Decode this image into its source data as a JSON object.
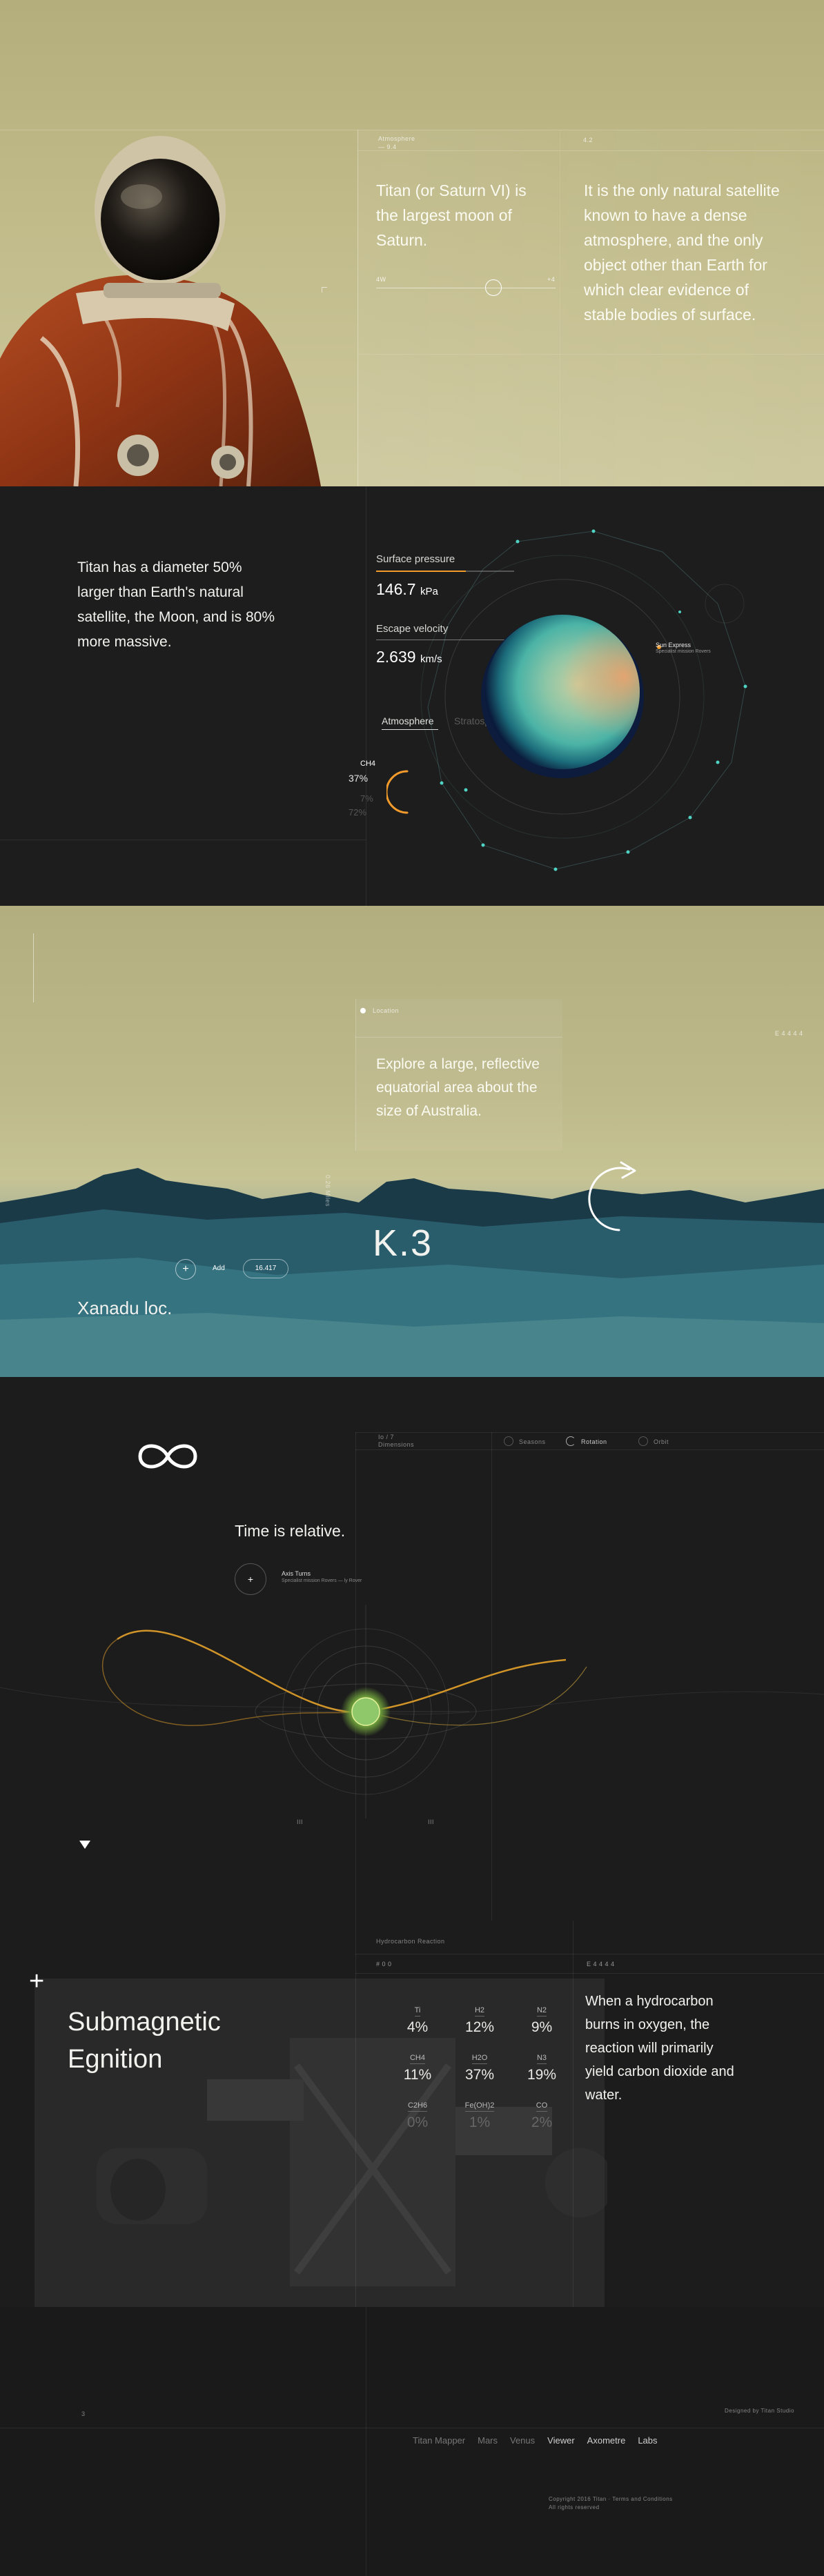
{
  "hero": {
    "panel_label_1": "Atmosphere",
    "panel_label_1b": "— 9.4",
    "panel_label_2": "4.2",
    "intro": "Titan (or Saturn VI) is the largest moon of Saturn.",
    "description": "It is the only natural satellite known to have a dense atmosphere, and the only object other than Earth for which clear evidence of stable bodies of surface.",
    "slider_min": "4W",
    "slider_max": "+4"
  },
  "stats": {
    "intro": "Titan has a diameter 50% larger than Earth's natural satellite, the Moon, and is 80% more massive.",
    "pressure_label": "Surface pressure",
    "pressure_value": "146.7",
    "pressure_unit": "kPa",
    "escape_label": "Escape velocity",
    "escape_value": "2.639",
    "escape_unit": "km/s",
    "tab_atmosphere": "Atmosphere",
    "tab_stratosphere": "Stratosphere",
    "gas_label": "CH4",
    "gas_main": "37%",
    "gas_second": "7%",
    "gas_third": "72%",
    "marker_title": "Sun Express",
    "marker_sub": "Specialist mission Rovers",
    "percent_label": "Pressure",
    "progress": 0.65
  },
  "terrain": {
    "panel_label": "Location",
    "coordinates": "E 4 4 4 4",
    "description": "Explore a large, reflective equatorial area about the size of Australia.",
    "k_value": "K.3",
    "location": "Xanadu loc.",
    "add_label": "Add",
    "pill_label": "16.417",
    "side_text": "0.26 Miles"
  },
  "time": {
    "title": "Time is relative.",
    "top_label_1": "Io / 7",
    "top_label_1b": "Dimensions",
    "tab_a": "Seasons",
    "tab_b": "Rotation",
    "tab_c": "Orbit",
    "marker_title": "Axis Turns",
    "marker_sub": "Specialist mission Rovers — ly Rover",
    "scale_label_a": "III",
    "scale_label_b": "III"
  },
  "ignition": {
    "title_line1": "Submagnetic",
    "title_line2": "Egnition",
    "panel_label": "Hydrocarbon Reaction",
    "panel_code": "# 0 0",
    "right_code": "E 4 4 4 4",
    "description": "When a hydrocarbon burns in oxygen, the reaction will primarily yield carbon dioxide and water.",
    "table": [
      [
        {
          "label": "Ti",
          "value": "4%"
        },
        {
          "label": "H2",
          "value": "12%"
        },
        {
          "label": "N2",
          "value": "9%"
        }
      ],
      [
        {
          "label": "CH4",
          "value": "11%"
        },
        {
          "label": "H2O",
          "value": "37%"
        },
        {
          "label": "N3",
          "value": "19%"
        }
      ],
      [
        {
          "label": "C2H6",
          "value": "0%"
        },
        {
          "label": "Fe(OH)2",
          "value": "1%"
        },
        {
          "label": "CO",
          "value": "2%"
        }
      ]
    ]
  },
  "footer": {
    "counter": "3",
    "right_meta": "Designed by Titan Studio",
    "nav": [
      "Titan Mapper",
      "Mars",
      "Venus",
      "Viewer",
      "Axometre",
      "Labs"
    ],
    "copyright": "Copyright 2016 Titan · Terms and Conditions",
    "copyright_sub": "All rights reserved"
  },
  "colors": {
    "accent_orange": "#f39b2b",
    "teal": "#4fd3c4",
    "sand": "#c1bb8a"
  }
}
